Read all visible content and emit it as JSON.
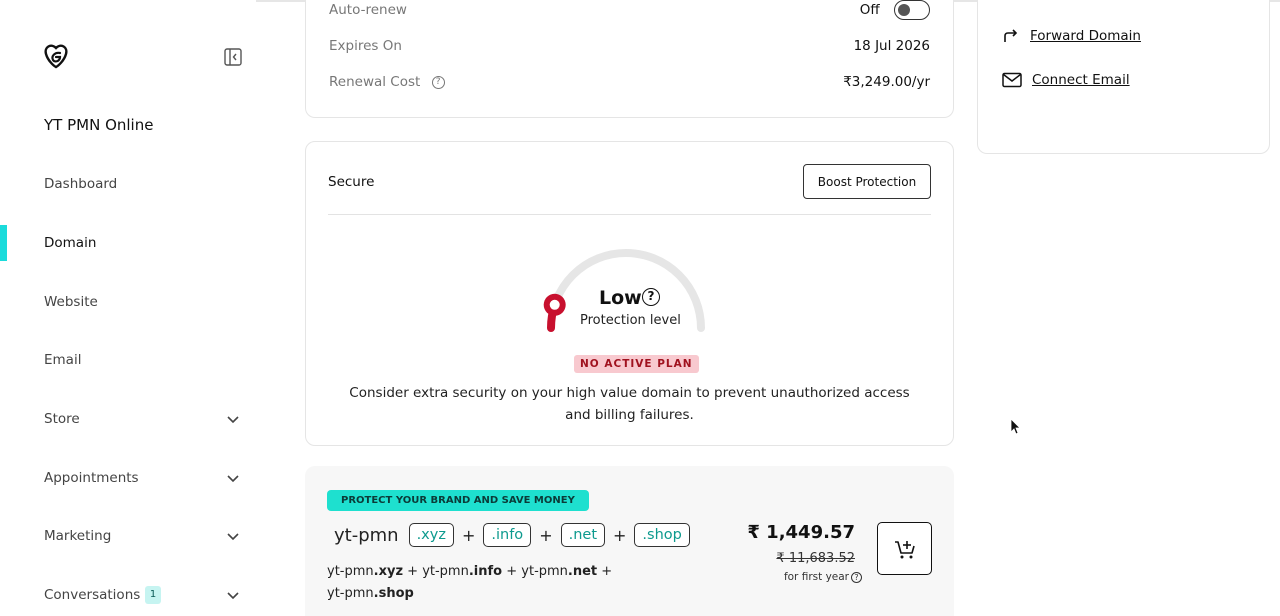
{
  "sidebar": {
    "site_name": "YT PMN Online",
    "items": [
      {
        "label": "Dashboard",
        "active": false
      },
      {
        "label": "Domain",
        "active": true
      },
      {
        "label": "Website",
        "active": false
      },
      {
        "label": "Email",
        "active": false
      },
      {
        "label": "Store",
        "active": false,
        "expandable": true
      },
      {
        "label": "Appointments",
        "active": false,
        "expandable": true
      },
      {
        "label": "Marketing",
        "active": false,
        "expandable": true
      },
      {
        "label": "Conversations",
        "active": false,
        "expandable": true,
        "badge": "1"
      }
    ]
  },
  "domain_info": {
    "auto_renew_label": "Auto-renew",
    "auto_renew_value": "Off",
    "expires_label": "Expires On",
    "expires_value": "18 Jul 2026",
    "renewal_label": "Renewal Cost",
    "renewal_value": "₹3,249.00/yr"
  },
  "secure": {
    "title": "Secure",
    "boost_button": "Boost Protection",
    "level": "Low",
    "level_help": "?",
    "level_sub": "Protection level",
    "status_badge": "NO ACTIVE PLAN",
    "description": "Consider extra security on your high value domain to prevent unauthorized access and billing failures.",
    "protection_level_fraction": 0.1
  },
  "bundle": {
    "tag": "PROTECT YOUR BRAND AND SAVE MONEY",
    "base": "yt-pmn",
    "tlds": [
      ".xyz",
      ".info",
      ".net",
      ".shop"
    ],
    "plus": "+",
    "desc_parts": [
      {
        "base": "yt-pmn",
        "tld": ".xyz"
      },
      {
        "base": "yt-pmn",
        "tld": ".info"
      },
      {
        "base": "yt-pmn",
        "tld": ".net"
      },
      {
        "base": "yt-pmn",
        "tld": ".shop"
      }
    ],
    "price": "₹ 1,449.57",
    "old_price": "₹ 11,683.52",
    "price_note": "for first year",
    "price_note_help": "?"
  },
  "right_panel": {
    "links": [
      {
        "label": "Forward Domain",
        "icon": "forward-arrow-icon"
      },
      {
        "label": "Connect Email",
        "icon": "envelope-icon"
      }
    ]
  },
  "colors": {
    "accent": "#1bdbdb",
    "gauge_red": "#c8102e",
    "badge_bg": "#f8c9cf",
    "promo_bg": "#1ee0cf"
  }
}
